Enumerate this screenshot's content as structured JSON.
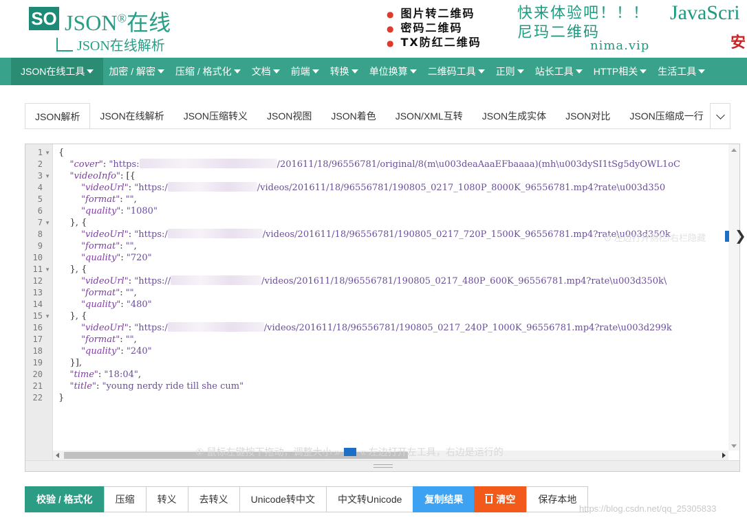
{
  "header": {
    "logo_box": "SO",
    "logo_main": "JSON",
    "logo_reg": "®",
    "logo_cn": "在线",
    "logo_sub": "JSON在线解析",
    "ads": [
      "图片转二维码",
      "密码二维码",
      "TX防红二维码"
    ],
    "ad_slogan": "快来体验吧！！！",
    "ad_slogan2": "尼玛二维码",
    "ad_site": "nima.vip",
    "ad_js": "JavaScri",
    "ad_js2": "安"
  },
  "nav": {
    "items": [
      {
        "label": "JSON在线工具",
        "active": true
      },
      {
        "label": "加密 / 解密"
      },
      {
        "label": "压缩 / 格式化"
      },
      {
        "label": "文档"
      },
      {
        "label": "前端"
      },
      {
        "label": "转换"
      },
      {
        "label": "单位换算"
      },
      {
        "label": "二维码工具"
      },
      {
        "label": "正则"
      },
      {
        "label": "站长工具"
      },
      {
        "label": "HTTP相关"
      },
      {
        "label": "生活工具"
      }
    ]
  },
  "tabs": {
    "items": [
      "JSON解析",
      "JSON在线解析",
      "JSON压缩转义",
      "JSON视图",
      "JSON着色",
      "JSON/XML互转",
      "JSON生成实体",
      "JSON对比",
      "JSON压缩成一行"
    ],
    "active": 0,
    "more_icon": "chevron-down-icon"
  },
  "editor": {
    "line_numbers": [
      "1",
      "2",
      "3",
      "4",
      "5",
      "6",
      "7",
      "8",
      "9",
      "10",
      "11",
      "12",
      "13",
      "14",
      "15",
      "16",
      "17",
      "18",
      "19",
      "20",
      "21",
      "22"
    ],
    "foldable": [
      "1",
      "3",
      "7",
      "11",
      "15"
    ],
    "lines": [
      {
        "indent": "",
        "parts": [
          {
            "t": "p",
            "v": "{"
          }
        ]
      },
      {
        "indent": "    ",
        "parts": [
          {
            "t": "k",
            "v": "\"cover\""
          },
          {
            "t": "p",
            "v": ": "
          },
          {
            "t": "s",
            "v": "\"https:"
          },
          {
            "t": "b",
            "w": 200
          },
          {
            "t": "s",
            "v": "/201611/18/96556781/original/8(m\\u003deaAaaEFbaaaa)(mh\\u003dySI1tSg5dyOWL1oC"
          }
        ]
      },
      {
        "indent": "    ",
        "parts": [
          {
            "t": "k",
            "v": "\"videoInfo\""
          },
          {
            "t": "p",
            "v": ": [{"
          }
        ]
      },
      {
        "indent": "        ",
        "parts": [
          {
            "t": "k",
            "v": "\"videoUrl\""
          },
          {
            "t": "p",
            "v": ": "
          },
          {
            "t": "s",
            "v": "\"https:/"
          },
          {
            "t": "b",
            "w": 130
          },
          {
            "t": "s",
            "v": "/videos/201611/18/96556781/190805_0217_1080P_8000K_96556781.mp4?rate\\u003d350"
          }
        ]
      },
      {
        "indent": "        ",
        "parts": [
          {
            "t": "k",
            "v": "\"format\""
          },
          {
            "t": "p",
            "v": ": "
          },
          {
            "t": "s",
            "v": "\"\""
          },
          {
            "t": "p",
            "v": ","
          }
        ]
      },
      {
        "indent": "        ",
        "parts": [
          {
            "t": "k",
            "v": "\"quality\""
          },
          {
            "t": "p",
            "v": ": "
          },
          {
            "t": "s",
            "v": "\"1080\""
          }
        ]
      },
      {
        "indent": "    ",
        "parts": [
          {
            "t": "p",
            "v": "}, {"
          }
        ]
      },
      {
        "indent": "        ",
        "parts": [
          {
            "t": "k",
            "v": "\"videoUrl\""
          },
          {
            "t": "p",
            "v": ": "
          },
          {
            "t": "s",
            "v": "\"https:/"
          },
          {
            "t": "b",
            "w": 138
          },
          {
            "t": "s",
            "v": "/videos/201611/18/96556781/190805_0217_720P_1500K_96556781.mp4?rate\\u003d350k"
          }
        ]
      },
      {
        "indent": "        ",
        "parts": [
          {
            "t": "k",
            "v": "\"format\""
          },
          {
            "t": "p",
            "v": ": "
          },
          {
            "t": "s",
            "v": "\"\""
          },
          {
            "t": "p",
            "v": ","
          }
        ]
      },
      {
        "indent": "        ",
        "parts": [
          {
            "t": "k",
            "v": "\"quality\""
          },
          {
            "t": "p",
            "v": ": "
          },
          {
            "t": "s",
            "v": "\"720\""
          }
        ]
      },
      {
        "indent": "    ",
        "parts": [
          {
            "t": "p",
            "v": "}, {"
          }
        ]
      },
      {
        "indent": "        ",
        "parts": [
          {
            "t": "k",
            "v": "\"videoUrl\""
          },
          {
            "t": "p",
            "v": ": "
          },
          {
            "t": "s",
            "v": "\"https://"
          },
          {
            "t": "b",
            "w": 132
          },
          {
            "t": "s",
            "v": "/videos/201611/18/96556781/190805_0217_480P_600K_96556781.mp4?rate\\u003d350k\\"
          }
        ]
      },
      {
        "indent": "        ",
        "parts": [
          {
            "t": "k",
            "v": "\"format\""
          },
          {
            "t": "p",
            "v": ": "
          },
          {
            "t": "s",
            "v": "\"\""
          },
          {
            "t": "p",
            "v": ","
          }
        ]
      },
      {
        "indent": "        ",
        "parts": [
          {
            "t": "k",
            "v": "\"quality\""
          },
          {
            "t": "p",
            "v": ": "
          },
          {
            "t": "s",
            "v": "\"480\""
          }
        ]
      },
      {
        "indent": "    ",
        "parts": [
          {
            "t": "p",
            "v": "}, {"
          }
        ]
      },
      {
        "indent": "        ",
        "parts": [
          {
            "t": "k",
            "v": "\"videoUrl\""
          },
          {
            "t": "p",
            "v": ": "
          },
          {
            "t": "s",
            "v": "\"https:/"
          },
          {
            "t": "b",
            "w": 140
          },
          {
            "t": "s",
            "v": "/videos/201611/18/96556781/190805_0217_240P_1000K_96556781.mp4?rate\\u003d299k"
          }
        ]
      },
      {
        "indent": "        ",
        "parts": [
          {
            "t": "k",
            "v": "\"format\""
          },
          {
            "t": "p",
            "v": ": "
          },
          {
            "t": "s",
            "v": "\"\""
          },
          {
            "t": "p",
            "v": ","
          }
        ]
      },
      {
        "indent": "        ",
        "parts": [
          {
            "t": "k",
            "v": "\"quality\""
          },
          {
            "t": "p",
            "v": ": "
          },
          {
            "t": "s",
            "v": "\"240\""
          }
        ]
      },
      {
        "indent": "    ",
        "parts": [
          {
            "t": "p",
            "v": "}],"
          }
        ]
      },
      {
        "indent": "    ",
        "parts": [
          {
            "t": "k",
            "v": "\"time\""
          },
          {
            "t": "p",
            "v": ": "
          },
          {
            "t": "s",
            "v": "\"18:04\""
          },
          {
            "t": "p",
            "v": ","
          }
        ]
      },
      {
        "indent": "    ",
        "parts": [
          {
            "t": "k",
            "v": "\"title\""
          },
          {
            "t": "p",
            "v": ": "
          },
          {
            "t": "s",
            "v": "\"young nerdy ride till she cum\""
          }
        ]
      },
      {
        "indent": "",
        "parts": [
          {
            "t": "p",
            "v": "}"
          }
        ]
      }
    ],
    "drag_hint": "① 鼠标左键按下拖动，调整大小 »",
    "drag_hint2": "« 左边打开左工具，右边是运行的",
    "side_hint": "⊙ 左边打开侧栏/右栏隐藏",
    "side_toggle": "❯"
  },
  "buttons": [
    {
      "label": "校验 / 格式化",
      "style": "primary"
    },
    {
      "label": "压缩",
      "style": "default"
    },
    {
      "label": "转义",
      "style": "default"
    },
    {
      "label": "去转义",
      "style": "default"
    },
    {
      "label": "Unicode转中文",
      "style": "default"
    },
    {
      "label": "中文转Unicode",
      "style": "default"
    },
    {
      "label": "复制结果",
      "style": "blue"
    },
    {
      "label": "清空",
      "style": "orange",
      "icon": "trash-icon"
    },
    {
      "label": "保存本地",
      "style": "default"
    }
  ],
  "watermark": "https://blog.csdn.net/qq_25305833",
  "colors": {
    "nav": "#38a38a",
    "nav_active": "#2b8c74",
    "primary": "#2c9c84",
    "blue": "#3ea2f3",
    "orange": "#f25a1b"
  }
}
